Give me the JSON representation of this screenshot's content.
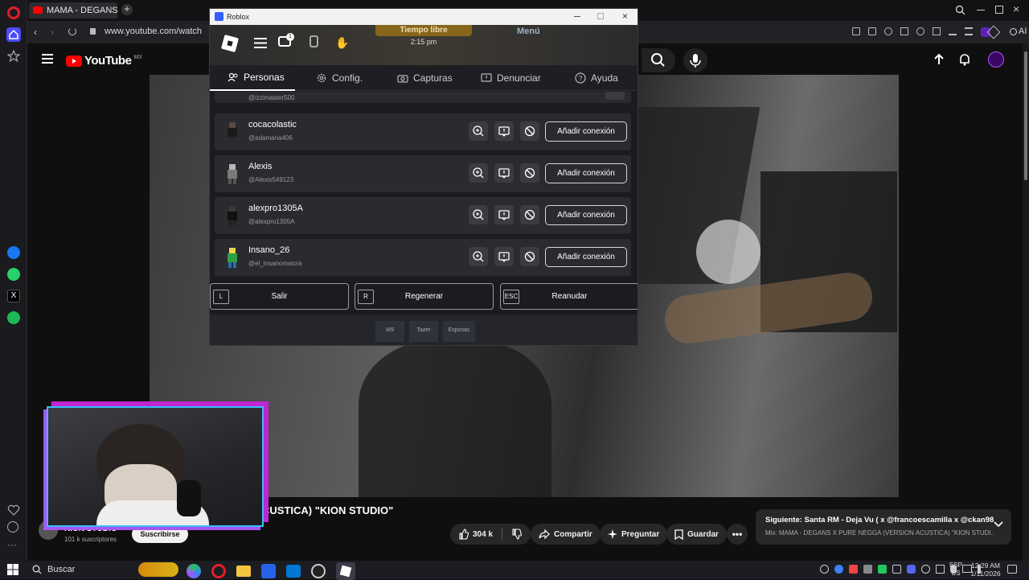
{
  "browser": {
    "tab_title": "MAMA - DEGANS X P",
    "url": "www.youtube.com/watch",
    "ai_label": "AI"
  },
  "youtube": {
    "logo_text": "YouTube",
    "region": "MX",
    "video_title": "(VERSION ACUSTICA) \"KION STUDIO\"",
    "video_title_visible": "CUSTICA) \"KION STUDIO\"",
    "channel_name": "KION STUDIO",
    "subscribers": "101 k suscriptores",
    "subscribe_label": "Suscribirse",
    "likes": "304 k",
    "share_label": "Compartir",
    "ask_label": "Preguntar",
    "save_label": "Guardar",
    "next_title": "Siguiente: Santa RM - Deja Vu ( x @francoescamilla x @ckan98 ...",
    "mix_title": "Mix: MAMA - DEGANS X PURE NEGGA (VERSION ACUSTICA) \"KION STUDI..."
  },
  "roblox": {
    "window_title": "Roblox",
    "free_time_label": "Tiempo libre",
    "time": "2:15 pm",
    "menu_label": "Menú",
    "notification_count": "1",
    "tabs": [
      {
        "label": "Personas"
      },
      {
        "label": "Config."
      },
      {
        "label": "Capturas"
      },
      {
        "label": "Denunciar"
      },
      {
        "label": "Ayuda"
      }
    ],
    "partial_handle": "@izzimaster500",
    "players": [
      {
        "name": "cocacolastic",
        "handle": "@adamaria406",
        "action": "Añadir conexión"
      },
      {
        "name": "Alexis",
        "handle": "@Alexis549123",
        "action": "Añadir conexión"
      },
      {
        "name": "alexpro1305A",
        "handle": "@alexpro1305A",
        "action": "Añadir conexión"
      },
      {
        "name": "Insano_26",
        "handle": "@el_insanomaicra",
        "action": "Añadir conexión"
      }
    ],
    "footer": [
      {
        "key": "L",
        "label": "Salir"
      },
      {
        "key": "R",
        "label": "Regenerar"
      },
      {
        "key": "ESC",
        "label": "Reanudar"
      }
    ],
    "hotbar": [
      "M9",
      "Tazer",
      "Esposas"
    ]
  },
  "taskbar": {
    "search_label": "Buscar",
    "lang": "ESP",
    "lang_sub": "US",
    "time": "12:29 AM",
    "date": "1/11/2026"
  },
  "colors": {
    "accent_red": "#ff0000",
    "opera_red": "#e11d2a",
    "webcam_border_blue": "#38bdf8",
    "webcam_border_purple": "#a855f7"
  }
}
